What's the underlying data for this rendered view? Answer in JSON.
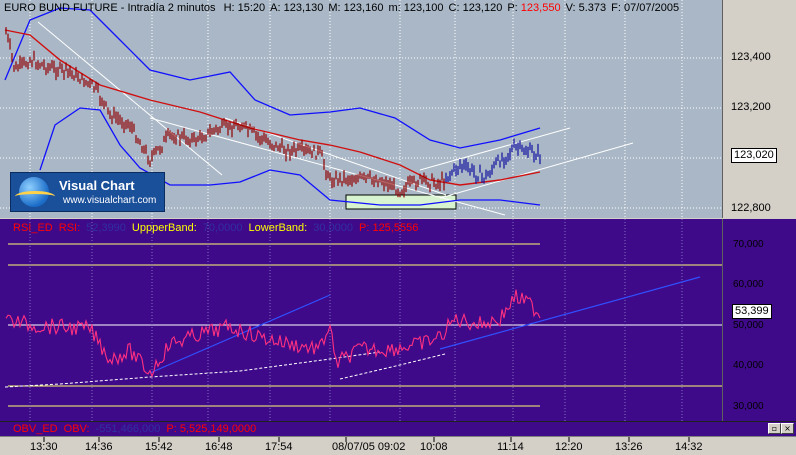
{
  "price_pane": {
    "title": "EURO BUND FUTURE - Intradía 2 minutos",
    "stats": [
      {
        "label": "H:",
        "value": "15:20"
      },
      {
        "label": "A:",
        "value": "123,130"
      },
      {
        "label": "M:",
        "value": "123,160"
      },
      {
        "label": "m:",
        "value": "123,100"
      },
      {
        "label": "C:",
        "value": "123,120"
      },
      {
        "label": "P:",
        "value": "123,550",
        "accent": "#ff0000"
      },
      {
        "label": "V:",
        "value": "5.373"
      },
      {
        "label": "F:",
        "value": "07/07/2005"
      }
    ],
    "scale": [
      "123,400",
      "123,200",
      "122,800"
    ],
    "current_price": "123,020",
    "bg_color": "#a9b7c6"
  },
  "logo": {
    "brand": "Visual Chart",
    "url": "www.visualchart.com"
  },
  "rsi_pane": {
    "title_parts": [
      {
        "text": "RSI_ED",
        "color": "#ff0000"
      },
      {
        "text": "RSI:",
        "color": "#ff0000"
      },
      {
        "text": "52,3990",
        "color": "#3030a0"
      },
      {
        "text": "UppperBand:",
        "color": "#ffff00"
      },
      {
        "text": "70,0000",
        "color": "#3030a0"
      },
      {
        "text": "LowerBand:",
        "color": "#ffff00"
      },
      {
        "text": "30,0000",
        "color": "#3030a0"
      },
      {
        "text": "P: 125,5556",
        "color": "#ff0000"
      }
    ],
    "scale": [
      "70,000",
      "60,000",
      "50,000",
      "40,000",
      "30,000"
    ],
    "current_value": "53,399",
    "bg_color": "#3f0a8a"
  },
  "obv_pane": {
    "title_parts": [
      {
        "text": "OBV_ED",
        "color": "#ff0000"
      },
      {
        "text": "OBV:",
        "color": "#ff0000"
      },
      {
        "text": "-551,466,000",
        "color": "#3030a0"
      },
      {
        "text": "P: 5,525,149,0000",
        "color": "#ff0000"
      }
    ]
  },
  "time_axis": [
    "13:30",
    "14:36",
    "15:42",
    "16:48",
    "17:54",
    "08/07/05 09:02",
    "10:08",
    "11:14",
    "12:20",
    "13:26",
    "14:32"
  ],
  "window_buttons": [
    "minimize",
    "maximize",
    "close"
  ]
}
